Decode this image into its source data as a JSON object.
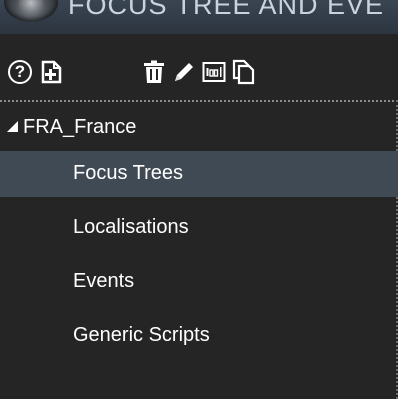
{
  "window": {
    "title": "FOCUS TREE AND EVE"
  },
  "toolbar": {
    "help_label": "?",
    "buttons": [
      {
        "name": "help",
        "icon": "help-circle-icon"
      },
      {
        "name": "new-file",
        "icon": "new-file-icon"
      },
      {
        "name": "delete",
        "icon": "trash-icon"
      },
      {
        "name": "edit",
        "icon": "pencil-icon"
      },
      {
        "name": "rename",
        "icon": "abc-text-icon"
      },
      {
        "name": "duplicate",
        "icon": "copy-icon"
      }
    ]
  },
  "tree": {
    "root": {
      "label": "FRA_France",
      "expanded": true
    },
    "children": [
      {
        "label": "Focus Trees",
        "selected": true
      },
      {
        "label": "Localisations",
        "selected": false
      },
      {
        "label": "Events",
        "selected": false
      },
      {
        "label": "Generic Scripts",
        "selected": false
      }
    ]
  },
  "colors": {
    "background": "#252526",
    "selected_row": "#404a54",
    "text": "#ffffff",
    "title_text": "#c8d3df",
    "separator": "#8a8a8a"
  }
}
